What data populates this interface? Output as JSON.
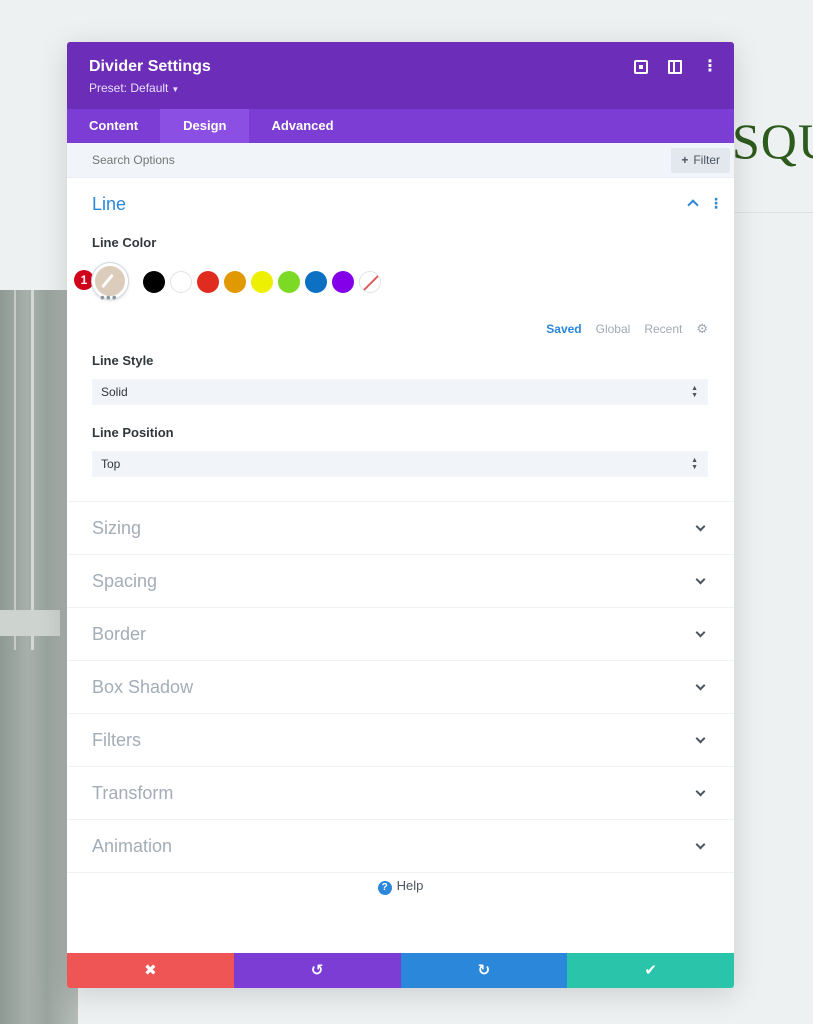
{
  "background": {
    "brand_text": "SQU"
  },
  "modal": {
    "title": "Divider Settings",
    "preset": "Preset: Default",
    "tabs": [
      {
        "label": "Content",
        "active": false
      },
      {
        "label": "Design",
        "active": true
      },
      {
        "label": "Advanced",
        "active": false
      }
    ],
    "search": {
      "placeholder": "Search Options"
    },
    "filter_label": "Filter",
    "line_section": {
      "title": "Line",
      "line_color_label": "Line Color",
      "badge": "1",
      "selected_color": "#dcccbb",
      "swatches": [
        "#000000",
        "#ffffff",
        "#e02b20",
        "#e09900",
        "#edf000",
        "#7cda24",
        "#0c71c3",
        "#8300e9",
        "none"
      ],
      "palette_tabs": [
        "Saved",
        "Global",
        "Recent"
      ],
      "line_style_label": "Line Style",
      "line_style_value": "Solid",
      "line_position_label": "Line Position",
      "line_position_value": "Top"
    },
    "sections": [
      "Sizing",
      "Spacing",
      "Border",
      "Box Shadow",
      "Filters",
      "Transform",
      "Animation"
    ],
    "help_label": "Help",
    "footer": {
      "cancel": "✖",
      "undo": "↺",
      "redo": "↻",
      "save": "✔"
    },
    "colors": {
      "header": "#6c2eb9",
      "tabs": "#7b3dd4",
      "accent": "#2b87da",
      "cancel": "#ef5555",
      "save": "#29c4a9"
    }
  }
}
